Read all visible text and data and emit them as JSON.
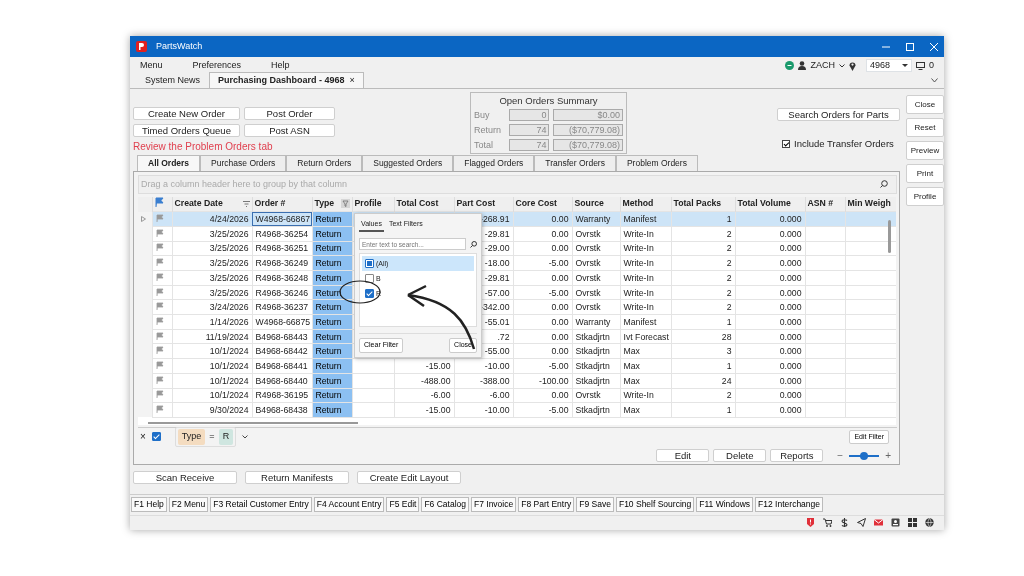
{
  "window": {
    "title": "PartsWatch"
  },
  "menu": [
    "Menu",
    "Preferences",
    "Help"
  ],
  "user": {
    "name": "ZACH",
    "store": "4968",
    "screens": "0"
  },
  "doc_tabs": [
    {
      "label": "System News",
      "selected": false
    },
    {
      "label": "Purchasing Dashboard - 4968",
      "selected": true,
      "close": "×"
    }
  ],
  "action_buttons": [
    "Create New Order",
    "Post Order",
    "Timed Orders Queue",
    "Post ASN"
  ],
  "notice": "Review the Problem Orders tab",
  "summary": {
    "title": "Open Orders Summary",
    "rows": [
      {
        "label": "Buy",
        "count": "0",
        "amount": "$0.00"
      },
      {
        "label": "Return",
        "count": "74",
        "amount": "($70,779.08)"
      },
      {
        "label": "Total",
        "count": "74",
        "amount": "($70,779.08)"
      }
    ]
  },
  "search_button": "Search Orders for Parts",
  "include_transfer": {
    "label": "Include Transfer Orders",
    "checked": true
  },
  "side_buttons": [
    "Close",
    "Reset",
    "Preview",
    "Print",
    "Profile"
  ],
  "order_tabs": [
    {
      "label": "All Orders",
      "selected": true
    },
    {
      "label": "Purchase Orders",
      "selected": false
    },
    {
      "label": "Return Orders",
      "selected": false
    },
    {
      "label": "Suggested Orders",
      "selected": false
    },
    {
      "label": "Flagged Orders",
      "selected": false
    },
    {
      "label": "Transfer Orders",
      "selected": false
    },
    {
      "label": "Problem Orders",
      "selected": false
    }
  ],
  "group_hint": "Drag a column header here to group by that column",
  "table": {
    "columns": [
      {
        "kind": "number",
        "label": "Create Date",
        "sorted": true,
        "filtered": false
      },
      {
        "kind": "text",
        "label": "Order #",
        "sorted": false,
        "filtered": false
      },
      {
        "kind": "text",
        "label": "Type",
        "sorted": false,
        "filtered": true
      },
      {
        "kind": "text",
        "label": "Profile",
        "sorted": false,
        "filtered": false
      },
      {
        "kind": "number",
        "label": "Total Cost",
        "sorted": false,
        "filtered": false
      },
      {
        "kind": "number",
        "label": "Part Cost",
        "sorted": false,
        "filtered": false
      },
      {
        "kind": "number",
        "label": "Core Cost",
        "sorted": false,
        "filtered": false
      },
      {
        "kind": "text",
        "label": "Source",
        "sorted": false,
        "filtered": false
      },
      {
        "kind": "text",
        "label": "Method",
        "sorted": false,
        "filtered": false
      },
      {
        "kind": "number",
        "label": "Total Packs",
        "sorted": false,
        "filtered": false
      },
      {
        "kind": "number",
        "label": "Total Volume",
        "sorted": false,
        "filtered": false
      },
      {
        "kind": "text",
        "label": "ASN #",
        "sorted": false,
        "filtered": false
      },
      {
        "kind": "text",
        "label": "Min Weigh",
        "sorted": false,
        "filtered": false
      }
    ],
    "rows": [
      {
        "selected": true,
        "cells": [
          "4/24/2026",
          "W4968-66867",
          "Return",
          null,
          null,
          "-268.91",
          "0.00",
          "Warranty",
          "Manifest",
          "1",
          "0.000",
          null,
          null
        ]
      },
      {
        "selected": false,
        "cells": [
          "3/25/2026",
          "R4968-36254",
          "Return",
          null,
          null,
          "-29.81",
          "0.00",
          "Ovrstk",
          "Write-In",
          "2",
          "0.000",
          null,
          null
        ]
      },
      {
        "selected": false,
        "cells": [
          "3/25/2026",
          "R4968-36251",
          "Return",
          null,
          null,
          "-29.00",
          "0.00",
          "Ovrstk",
          "Write-In",
          "2",
          "0.000",
          null,
          null
        ]
      },
      {
        "selected": false,
        "cells": [
          "3/25/2026",
          "R4968-36249",
          "Return",
          null,
          null,
          "-18.00",
          "-5.00",
          "Ovrstk",
          "Write-In",
          "2",
          "0.000",
          null,
          null
        ]
      },
      {
        "selected": false,
        "cells": [
          "3/25/2026",
          "R4968-36248",
          "Return",
          null,
          null,
          "-29.81",
          "0.00",
          "Ovrstk",
          "Write-In",
          "2",
          "0.000",
          null,
          null
        ]
      },
      {
        "selected": false,
        "cells": [
          "3/25/2026",
          "R4968-36246",
          "Return",
          null,
          null,
          "-57.00",
          "-5.00",
          "Ovrstk",
          "Write-In",
          "2",
          "0.000",
          null,
          null
        ]
      },
      {
        "selected": false,
        "cells": [
          "3/24/2026",
          "R4968-36237",
          "Return",
          null,
          null,
          "-342.00",
          "0.00",
          "Ovrstk",
          "Write-In",
          "2",
          "0.000",
          null,
          null
        ]
      },
      {
        "selected": false,
        "cells": [
          "1/14/2026",
          "W4968-66875",
          "Return",
          null,
          null,
          "-55.01",
          "0.00",
          "Warranty",
          "Manifest",
          "1",
          "0.000",
          null,
          null
        ]
      },
      {
        "selected": false,
        "cells": [
          "11/19/2024",
          "B4968-68443",
          "Return",
          null,
          null,
          ".72",
          "0.00",
          "Stkadjrtn",
          "Ivt Forecast",
          "28",
          "0.000",
          null,
          null
        ]
      },
      {
        "selected": false,
        "cells": [
          "10/1/2024",
          "B4968-68442",
          "Return",
          null,
          null,
          "-55.00",
          "0.00",
          "Stkadjrtn",
          "Max",
          "3",
          "0.000",
          null,
          null
        ]
      },
      {
        "selected": false,
        "cells": [
          "10/1/2024",
          "B4968-68441",
          "Return",
          null,
          "-15.00",
          "-10.00",
          "-5.00",
          "Stkadjrtn",
          "Max",
          "1",
          "0.000",
          null,
          null
        ]
      },
      {
        "selected": false,
        "cells": [
          "10/1/2024",
          "B4968-68440",
          "Return",
          null,
          "-488.00",
          "-388.00",
          "-100.00",
          "Stkadjrtn",
          "Max",
          "24",
          "0.000",
          null,
          null
        ]
      },
      {
        "selected": false,
        "cells": [
          "10/1/2024",
          "R4968-36195",
          "Return",
          null,
          "-6.00",
          "-6.00",
          "0.00",
          "Ovrstk",
          "Write-In",
          "2",
          "0.000",
          null,
          null
        ]
      },
      {
        "selected": false,
        "cells": [
          "9/30/2024",
          "B4968-68438",
          "Return",
          null,
          "-15.00",
          "-10.00",
          "-5.00",
          "Stkadjrtn",
          "Max",
          "1",
          "0.000",
          null,
          null
        ]
      }
    ]
  },
  "filter_popup": {
    "tabs": [
      {
        "label": "Values",
        "selected": true
      },
      {
        "label": "Text Filters",
        "selected": false
      }
    ],
    "placeholder": "Enter text to search...",
    "options": [
      {
        "label": "(All)",
        "checked": false,
        "indeterminate": true,
        "selected": true
      },
      {
        "label": "B",
        "checked": false,
        "indeterminate": false,
        "selected": false
      },
      {
        "label": "R",
        "checked": true,
        "indeterminate": false,
        "selected": false
      }
    ],
    "buttons": [
      "Clear Filter",
      "Close"
    ]
  },
  "filter_bar": {
    "clear": "×",
    "enabled": true,
    "field": "Type",
    "operator": "=",
    "value": "R",
    "edit_button": "Edit Filter"
  },
  "grid_buttons": [
    "Edit",
    "Delete",
    "Reports"
  ],
  "zoom": {
    "minus": "−",
    "plus": "+",
    "level": 0.5
  },
  "lower_buttons": [
    "Scan Receive",
    "Return Manifests",
    "Create Edit Layout"
  ],
  "function_keys": [
    "F1 Help",
    "F2 Menu",
    "F3 Retail Customer Entry",
    "F4 Account Entry",
    "F5 Edit",
    "F6 Catalog",
    "F7 Invoice",
    "F8 Part Entry",
    "F9 Save",
    "F10 Shelf Sourcing",
    "F11 Windows",
    "F12 Interchange"
  ]
}
